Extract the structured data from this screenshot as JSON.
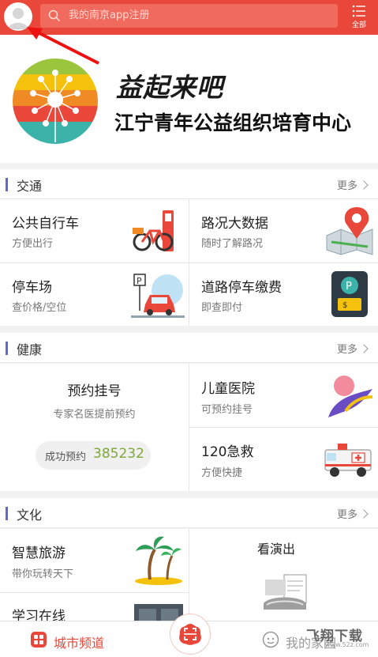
{
  "header": {
    "search_placeholder": "我的南京app注册",
    "menu_label": "全部"
  },
  "banner": {
    "slogan": "益起来吧",
    "org_name": "江宁青年公益组织培育中心"
  },
  "sections": {
    "traffic": {
      "title": "交通",
      "more": "更多",
      "items": [
        {
          "title": "公共自行车",
          "sub": "方便出行",
          "icon": "bicycle-icon"
        },
        {
          "title": "路况大数据",
          "sub": "随时了解路况",
          "icon": "map-pin-icon"
        },
        {
          "title": "停车场",
          "sub": "查价格/空位",
          "icon": "parking-car-icon"
        },
        {
          "title": "道路停车缴费",
          "sub": "即查即付",
          "icon": "parking-meter-icon"
        }
      ]
    },
    "health": {
      "title": "健康",
      "more": "更多",
      "register": {
        "title": "预约挂号",
        "sub": "专家名医提前预约",
        "badge_label": "成功预约",
        "badge_count": "385232"
      },
      "items": [
        {
          "title": "儿童医院",
          "sub": "可预约挂号",
          "icon": "child-hospital-icon"
        },
        {
          "title": "120急救",
          "sub": "方便快捷",
          "icon": "ambulance-icon"
        }
      ]
    },
    "culture": {
      "title": "文化",
      "more": "更多",
      "items": [
        {
          "title": "智慧旅游",
          "sub": "带你玩转天下",
          "icon": "palm-tree-icon"
        },
        {
          "title": "学习在线",
          "sub": "",
          "icon": "monitor-icon"
        }
      ],
      "show": {
        "title": "看演出",
        "icon": "theater-icon"
      }
    }
  },
  "bottom_nav": {
    "city_label": "城市频道",
    "mine_label": "我的家园"
  },
  "watermark": {
    "text": "飞翔下载",
    "sub": "www.52z.com"
  },
  "colors": {
    "brand": "#e8473a",
    "accent_bar": "#5e6ad2",
    "count": "#7fa83a"
  }
}
